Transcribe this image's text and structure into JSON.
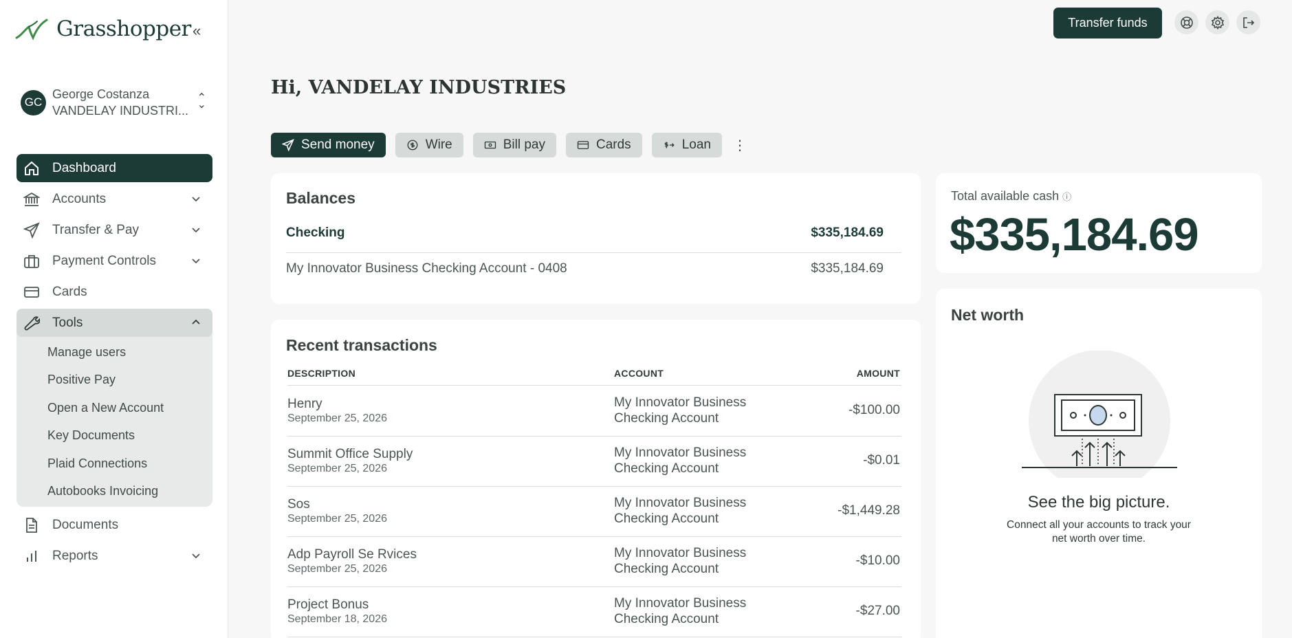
{
  "brand": {
    "name": "Grasshopper",
    "primary_color": "#1d3b36"
  },
  "user": {
    "initials": "GC",
    "name": "George Costanza",
    "company": "VANDELAY INDUSTRI..."
  },
  "sidebar": {
    "items": [
      {
        "label": "Dashboard",
        "icon": "home-icon",
        "active": true
      },
      {
        "label": "Accounts",
        "icon": "bank-icon",
        "expandable": true
      },
      {
        "label": "Transfer & Pay",
        "icon": "send-icon",
        "expandable": true
      },
      {
        "label": "Payment Controls",
        "icon": "briefcase-icon",
        "expandable": true
      },
      {
        "label": "Cards",
        "icon": "card-icon"
      },
      {
        "label": "Tools",
        "icon": "wrench-icon",
        "expanded": true
      },
      {
        "label": "Documents",
        "icon": "document-icon"
      },
      {
        "label": "Reports",
        "icon": "bar-chart-icon",
        "expandable": true
      }
    ],
    "tools_subitems": [
      "Manage users",
      "Positive Pay",
      "Open a New Account",
      "Key Documents",
      "Plaid Connections",
      "Autobooks Invoicing"
    ]
  },
  "header": {
    "transfer_label": "Transfer funds"
  },
  "main": {
    "greeting": "Hi, VANDELAY INDUSTRIES",
    "actions": {
      "send_money": "Send money",
      "wire": "Wire",
      "bill_pay": "Bill pay",
      "cards": "Cards",
      "loan": "Loan"
    }
  },
  "balances": {
    "title": "Balances",
    "group_label": "Checking",
    "group_total": "$335,184.69",
    "accounts": [
      {
        "name": "My Innovator Business Checking Account - 0408",
        "balance": "$335,184.69"
      }
    ]
  },
  "transactions": {
    "title": "Recent transactions",
    "columns": {
      "description": "DESCRIPTION",
      "account": "ACCOUNT",
      "amount": "AMOUNT"
    },
    "rows": [
      {
        "description": "Henry",
        "date": "September 25, 2026",
        "account": "My Innovator Business Checking Account",
        "amount": "-$100.00"
      },
      {
        "description": "Summit Office Supply",
        "date": "September 25, 2026",
        "account": "My Innovator Business Checking Account",
        "amount": "-$0.01"
      },
      {
        "description": "Sos",
        "date": "September 25, 2026",
        "account": "My Innovator Business Checking Account",
        "amount": "-$1,449.28"
      },
      {
        "description": "Adp Payroll Se Rvices",
        "date": "September 25, 2026",
        "account": "My Innovator Business Checking Account",
        "amount": "-$10.00"
      },
      {
        "description": "Project Bonus",
        "date": "September 18, 2026",
        "account": "My Innovator Business Checking Account",
        "amount": "-$27.00"
      }
    ]
  },
  "cash": {
    "label": "Total available cash",
    "value": "$335,184.69"
  },
  "net_worth": {
    "title": "Net worth",
    "heading": "See the big picture.",
    "subtext": "Connect all your accounts to track your net worth over time."
  }
}
